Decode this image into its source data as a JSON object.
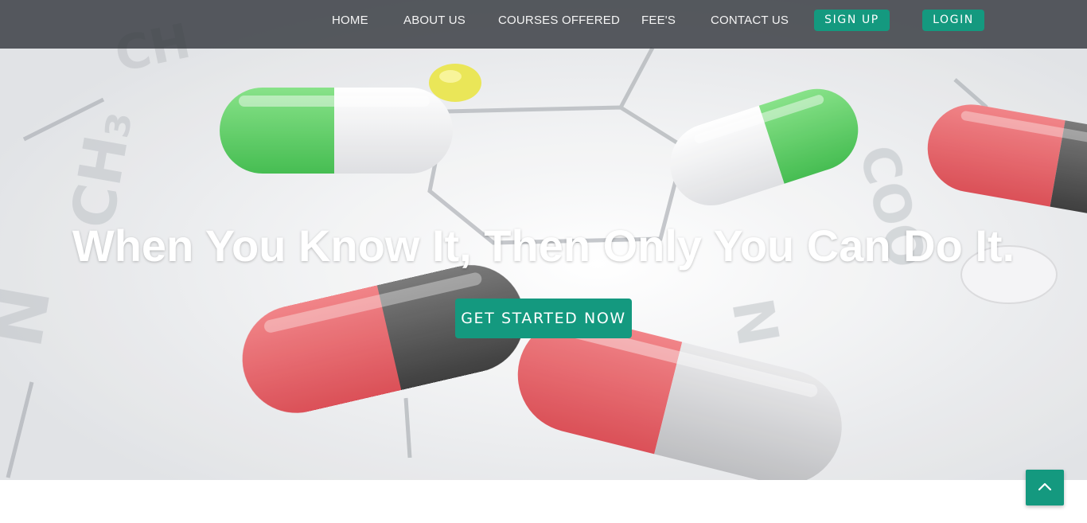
{
  "nav": {
    "links": [
      "HOME",
      "ABOUT US",
      "COURSES OFFERED",
      "FEE'S",
      "CONTACT US"
    ],
    "signup_label": "SIGN UP",
    "login_label": "LOGIN"
  },
  "hero": {
    "headline": "When You Know It, Then Only You Can Do It.",
    "cta_label": "GET STARTED NOW",
    "background": "pharmacy capsules on chemical structure"
  },
  "scroll_top": {
    "icon": "chevron-up-icon"
  },
  "colors": {
    "accent": "#14997f",
    "navbar": "#34383e",
    "capsule_green": "#45c84f",
    "capsule_red": "#e54b52",
    "capsule_dark": "#3a3a3a"
  }
}
